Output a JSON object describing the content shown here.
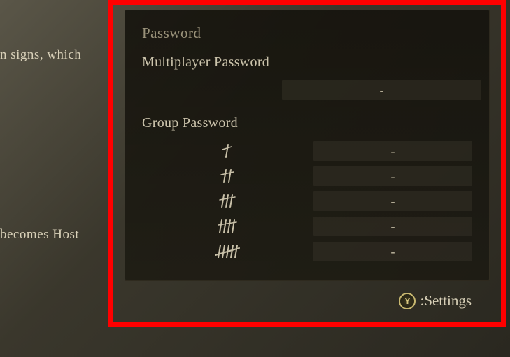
{
  "background": {
    "text1": "n signs, which",
    "text2": "becomes Host"
  },
  "panel": {
    "title": "Password",
    "multiplayer": {
      "label": "Multiplayer Password",
      "value": "-"
    },
    "group": {
      "label": "Group Password",
      "rows": [
        {
          "tally": 1,
          "value": "-"
        },
        {
          "tally": 2,
          "value": "-"
        },
        {
          "tally": 3,
          "value": "-"
        },
        {
          "tally": 4,
          "value": "-"
        },
        {
          "tally": 5,
          "value": "-"
        }
      ]
    }
  },
  "hint": {
    "button": "Y",
    "label": ":Settings"
  }
}
